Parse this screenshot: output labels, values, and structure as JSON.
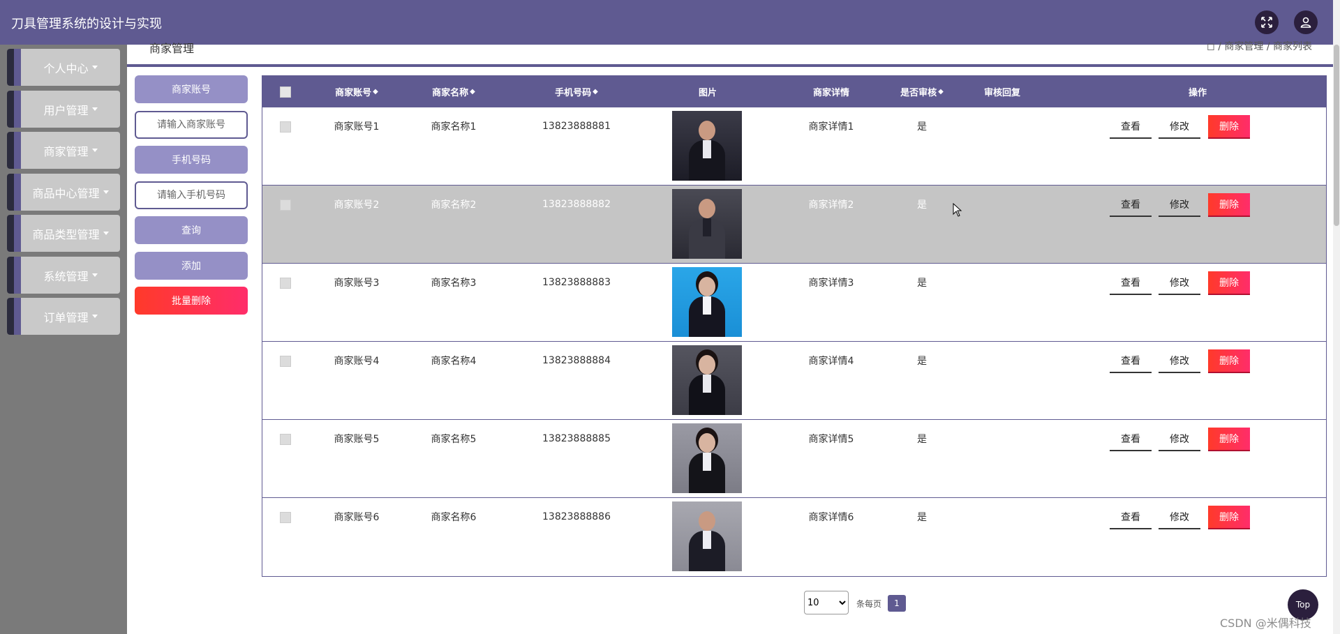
{
  "app": {
    "title": "刀具管理系统的设计与实现",
    "accent_color": "#5f5a91",
    "icons": {
      "fullscreen": "fullscreen-icon",
      "user": "user-icon"
    }
  },
  "sidebar": {
    "items": [
      {
        "label": "个人中心"
      },
      {
        "label": "用户管理"
      },
      {
        "label": "商家管理"
      },
      {
        "label": "商品中心管理"
      },
      {
        "label": "商品类型管理"
      },
      {
        "label": "系统管理"
      },
      {
        "label": "订单管理"
      }
    ]
  },
  "header": {
    "title": "商家管理",
    "breadcrumb": {
      "home_icon": "home-icon",
      "section": "商家管理",
      "current": "商家列表",
      "separator": "/"
    }
  },
  "search": {
    "account_label": "商家账号",
    "account_placeholder": "请输入商家账号",
    "phone_label": "手机号码",
    "phone_placeholder": "请输入手机号码",
    "query_label": "查询",
    "add_label": "添加",
    "batch_delete_label": "批量删除"
  },
  "table": {
    "headers": {
      "account": "商家账号",
      "name": "商家名称",
      "phone": "手机号码",
      "photo": "图片",
      "detail": "商家详情",
      "approved": "是否审核",
      "reply": "审核回复",
      "actions": "操作"
    },
    "actions": {
      "view": "查看",
      "edit": "修改",
      "delete": "删除"
    },
    "rows": [
      {
        "account": "商家账号1",
        "name": "商家名称1",
        "phone": "13823888881",
        "detail": "商家详情1",
        "approved": "是",
        "reply": ""
      },
      {
        "account": "商家账号2",
        "name": "商家名称2",
        "phone": "13823888882",
        "detail": "商家详情2",
        "approved": "是",
        "reply": ""
      },
      {
        "account": "商家账号3",
        "name": "商家名称3",
        "phone": "13823888883",
        "detail": "商家详情3",
        "approved": "是",
        "reply": ""
      },
      {
        "account": "商家账号4",
        "name": "商家名称4",
        "phone": "13823888884",
        "detail": "商家详情4",
        "approved": "是",
        "reply": ""
      },
      {
        "account": "商家账号5",
        "name": "商家名称5",
        "phone": "13823888885",
        "detail": "商家详情5",
        "approved": "是",
        "reply": ""
      },
      {
        "account": "商家账号6",
        "name": "商家名称6",
        "phone": "13823888886",
        "detail": "商家详情6",
        "approved": "是",
        "reply": ""
      }
    ]
  },
  "pagination": {
    "page_size": "10",
    "per_page_label": "条每页",
    "current_page": "1"
  },
  "back_to_top": "Top",
  "watermark": "CSDN @米偶科技"
}
